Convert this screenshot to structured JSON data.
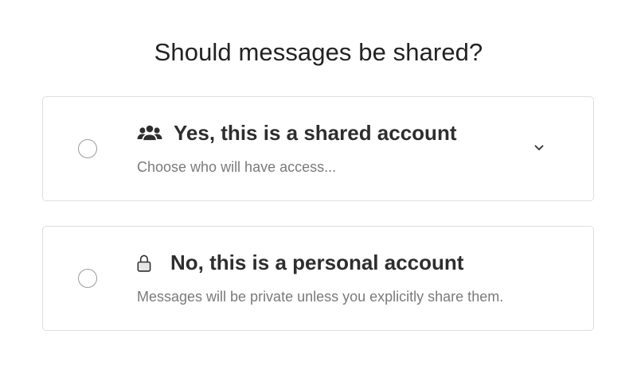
{
  "question": "Should messages be shared?",
  "options": [
    {
      "title": "Yes, this is a shared account",
      "description": "Choose who will have access...",
      "icon": "group-icon",
      "selected": false,
      "expandable": true
    },
    {
      "title": "No, this is a personal account",
      "description": "Messages will be private unless you explicitly share them.",
      "icon": "lock-icon",
      "selected": false,
      "expandable": false
    }
  ],
  "colors": {
    "border": "#dedede",
    "title": "#2e2e2e",
    "description": "#7a7a7a",
    "radio_border": "#9a9a9a"
  }
}
